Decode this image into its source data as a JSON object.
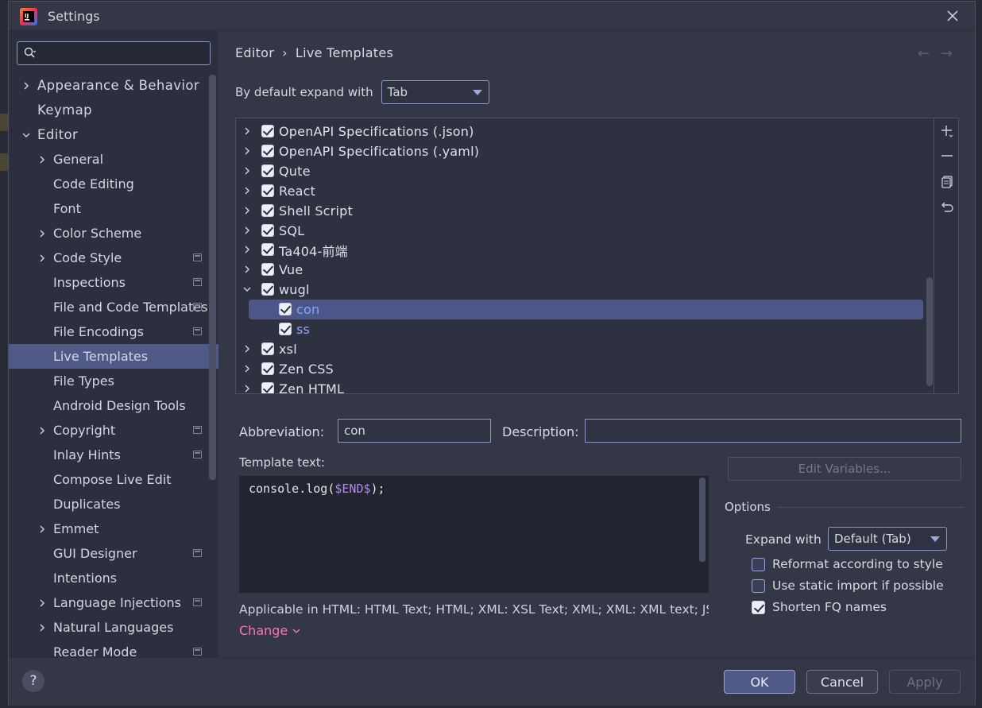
{
  "window": {
    "title": "Settings"
  },
  "search": {
    "placeholder": ""
  },
  "sidebar": {
    "items": [
      {
        "label": "Appearance & Behavior",
        "level": 0,
        "chevron": "right"
      },
      {
        "label": "Keymap",
        "level": 0,
        "chevron": "none"
      },
      {
        "label": "Editor",
        "level": 0,
        "chevron": "down"
      },
      {
        "label": "General",
        "level": 1,
        "chevron": "right"
      },
      {
        "label": "Code Editing",
        "level": 1,
        "chevron": "none"
      },
      {
        "label": "Font",
        "level": 1,
        "chevron": "none"
      },
      {
        "label": "Color Scheme",
        "level": 1,
        "chevron": "right"
      },
      {
        "label": "Code Style",
        "level": 1,
        "chevron": "right",
        "project": true
      },
      {
        "label": "Inspections",
        "level": 1,
        "chevron": "none",
        "project": true
      },
      {
        "label": "File and Code Templates",
        "level": 1,
        "chevron": "none",
        "project": true
      },
      {
        "label": "File Encodings",
        "level": 1,
        "chevron": "none",
        "project": true
      },
      {
        "label": "Live Templates",
        "level": 1,
        "chevron": "none",
        "selected": true
      },
      {
        "label": "File Types",
        "level": 1,
        "chevron": "none"
      },
      {
        "label": "Android Design Tools",
        "level": 1,
        "chevron": "none"
      },
      {
        "label": "Copyright",
        "level": 1,
        "chevron": "right",
        "project": true
      },
      {
        "label": "Inlay Hints",
        "level": 1,
        "chevron": "none",
        "project": true
      },
      {
        "label": "Compose Live Edit",
        "level": 1,
        "chevron": "none"
      },
      {
        "label": "Duplicates",
        "level": 1,
        "chevron": "none"
      },
      {
        "label": "Emmet",
        "level": 1,
        "chevron": "right"
      },
      {
        "label": "GUI Designer",
        "level": 1,
        "chevron": "none",
        "project": true
      },
      {
        "label": "Intentions",
        "level": 1,
        "chevron": "none"
      },
      {
        "label": "Language Injections",
        "level": 1,
        "chevron": "right",
        "project": true
      },
      {
        "label": "Natural Languages",
        "level": 1,
        "chevron": "right"
      },
      {
        "label": "Reader Mode",
        "level": 1,
        "chevron": "none",
        "project": true
      }
    ]
  },
  "breadcrumb": {
    "parent": "Editor",
    "separator": "›",
    "current": "Live Templates"
  },
  "nav": {
    "back": "←",
    "forward": "→"
  },
  "expand_default": {
    "label": "By default expand with",
    "value": "Tab"
  },
  "templates": {
    "rows": [
      {
        "label": "OpenAPI Specifications (.json)",
        "level": 0,
        "chevron": "right",
        "checked": true
      },
      {
        "label": "OpenAPI Specifications (.yaml)",
        "level": 0,
        "chevron": "right",
        "checked": true
      },
      {
        "label": "Qute",
        "level": 0,
        "chevron": "right",
        "checked": true
      },
      {
        "label": "React",
        "level": 0,
        "chevron": "right",
        "checked": true
      },
      {
        "label": "Shell Script",
        "level": 0,
        "chevron": "right",
        "checked": true
      },
      {
        "label": "SQL",
        "level": 0,
        "chevron": "right",
        "checked": true
      },
      {
        "label": "Ta404-前端",
        "level": 0,
        "chevron": "right",
        "checked": true
      },
      {
        "label": "Vue",
        "level": 0,
        "chevron": "right",
        "checked": true
      },
      {
        "label": "wugl",
        "level": 0,
        "chevron": "down",
        "checked": true
      },
      {
        "label": "con",
        "level": 1,
        "chevron": "none",
        "checked": true,
        "selected": true
      },
      {
        "label": "ss",
        "level": 1,
        "chevron": "none",
        "checked": true
      },
      {
        "label": "xsl",
        "level": 0,
        "chevron": "right",
        "checked": true
      },
      {
        "label": "Zen CSS",
        "level": 0,
        "chevron": "right",
        "checked": true
      },
      {
        "label": "Zen HTML",
        "level": 0,
        "chevron": "right",
        "checked": true
      }
    ]
  },
  "form": {
    "abbreviation_label": "Abbreviation:",
    "abbreviation_value": "con",
    "description_label": "Description:",
    "description_value": "",
    "template_text_label": "Template text:",
    "template_code_prefix": "console.log(",
    "template_code_var": "$END$",
    "template_code_suffix": ");",
    "edit_variables": "Edit Variables...",
    "applicable": "Applicable in HTML: HTML Text; HTML; XML: XSL Text; XML; XML: XML text; JSP; XML...",
    "change": "Change"
  },
  "options": {
    "title": "Options",
    "expand_with_label": "Expand with",
    "expand_with_value": "Default (Tab)",
    "reformat": {
      "label": "Reformat according to style",
      "checked": false
    },
    "static_import": {
      "label": "Use static import if possible",
      "checked": false
    },
    "shorten_fq": {
      "label": "Shorten FQ names",
      "checked": true
    }
  },
  "footer": {
    "help": "?",
    "ok": "OK",
    "cancel": "Cancel",
    "apply": "Apply"
  },
  "colors": {
    "accent": "#515a87",
    "link": "#f07bb0",
    "leaf_template": "#82aaff",
    "variable": "#b18be8"
  }
}
